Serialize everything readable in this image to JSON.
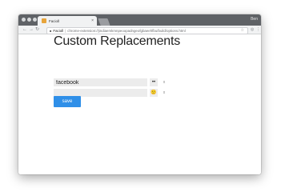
{
  "browser": {
    "tab_title": "Facioll",
    "tab_close": "×",
    "profile": "Ben",
    "omnibox": {
      "secure_label": "Facioll",
      "separator": "|",
      "url": "chrome-extension://jindiaemkmnpeoopadngeofgbaeehfbu/build/options.html"
    },
    "icons": {
      "back": "←",
      "forward": "→",
      "reload": "↻",
      "star": "☆",
      "extension": "◎",
      "menu": "⋮"
    }
  },
  "page": {
    "title": "Custom Replacements",
    "rows": [
      {
        "word": "facebook",
        "emoji": "••",
        "remove": "x"
      },
      {
        "word": "",
        "emoji": "🙁",
        "remove": "x"
      }
    ],
    "save_label": "save"
  },
  "colors": {
    "titlebar": "#5f6266",
    "toolbar": "#f1f2f3",
    "save_button": "#2f8fe8",
    "input_background": "#ececec"
  }
}
